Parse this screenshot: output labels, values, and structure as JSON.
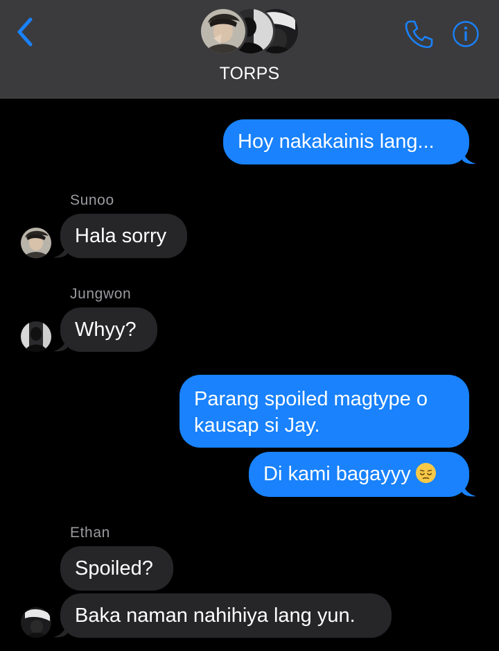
{
  "header": {
    "title": "TORPS",
    "back_icon": "chevron-left-icon",
    "call_icon": "phone-icon",
    "info_icon": "info-icon",
    "accent_color": "#1982fc"
  },
  "messages": {
    "m1": {
      "text": "Hoy nakakainis lang...",
      "direction": "outgoing"
    },
    "m2": {
      "sender": "Sunoo",
      "text": "Hala sorry",
      "direction": "incoming"
    },
    "m3": {
      "sender": "Jungwon",
      "text": "Whyy?",
      "direction": "incoming"
    },
    "m4": {
      "text": "Parang spoiled magtype o kausap si Jay.",
      "direction": "outgoing"
    },
    "m5": {
      "text": "Di kami bagayyy",
      "emoji": "pensive-face",
      "direction": "outgoing"
    },
    "m6": {
      "sender": "Ethan",
      "text": "Spoiled?",
      "direction": "incoming"
    },
    "m7": {
      "text": "Baka naman nahihiya lang yun.",
      "direction": "incoming"
    }
  },
  "colors": {
    "outgoing_bubble": "#1982fc",
    "incoming_bubble": "#262629",
    "header_bg": "#3b3b3d",
    "sender_name": "#9a9aa0"
  }
}
